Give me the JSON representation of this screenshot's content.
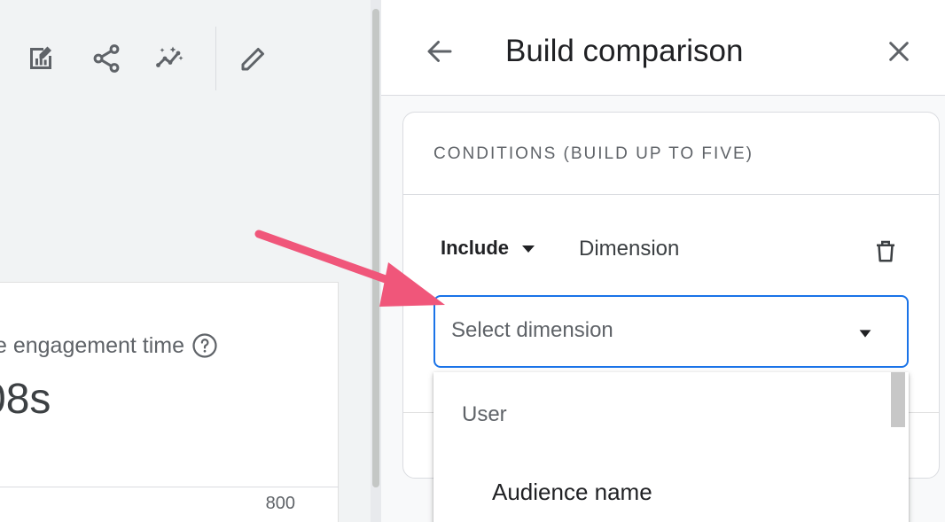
{
  "toolbar": {
    "icons": [
      "edit-report-icon",
      "share-icon",
      "insights-icon",
      "pencil-icon"
    ]
  },
  "metric_card": {
    "label": "e engagement time",
    "value": "08s",
    "axis_tick": "800"
  },
  "panel": {
    "title": "Build comparison",
    "conditions": {
      "heading": "CONDITIONS (BUILD UP TO FIVE)",
      "include_label": "Include",
      "dimension_label": "Dimension",
      "select_placeholder": "Select dimension"
    }
  },
  "dropdown": {
    "group_label": "User",
    "options": [
      "Audience name"
    ]
  },
  "colors": {
    "accent": "#1a73e8",
    "annotation": "#f0567a",
    "panel_bg": "#f8f9fa",
    "report_bg": "#f1f3f4"
  }
}
